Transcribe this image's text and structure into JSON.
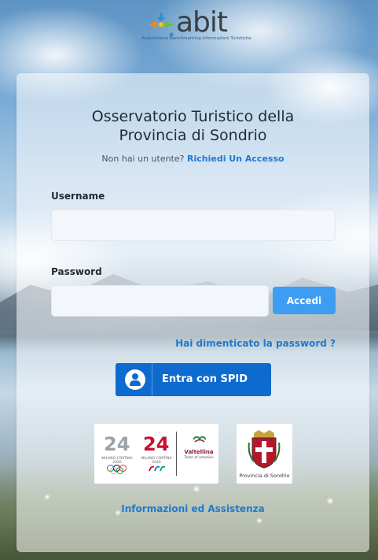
{
  "logo": {
    "name": "abit",
    "tagline": "Acquisizione  Benchmarking Informazioni Turistiche"
  },
  "header": {
    "title_line1": "Osservatorio Turistico della",
    "title_line2": "Provincia di Sondrio"
  },
  "signup": {
    "prompt": "Non hai un utente?",
    "link": "Richiedi Un Accesso"
  },
  "form": {
    "username_label": "Username",
    "username_value": "",
    "password_label": "Password",
    "password_value": "",
    "submit_label": "Accedi",
    "forgot_link": "Hai dimenticato la password ?"
  },
  "spid": {
    "label": "Entra con SPID"
  },
  "partners": {
    "mc1_num": "24",
    "mc1_text": "MILANO CORTINA 2026",
    "mc2_num": "24",
    "mc2_text": "MILANO CORTINA 2026",
    "valtellina_name": "Valtellina",
    "valtellina_tag": "Taste of emotion",
    "province_name": "Provincia di Sondrio"
  },
  "footer": {
    "info_link": "Informazioni ed Assistenza"
  },
  "colors": {
    "accent": "#3d9df2",
    "link": "#1e7ad1",
    "spid": "#0d6acf"
  }
}
